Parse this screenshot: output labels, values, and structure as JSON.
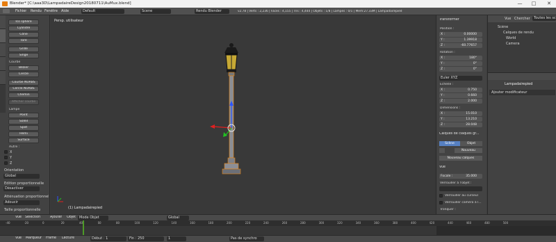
{
  "window": {
    "title": "Blender* [C:\\aaa3D\\LampadaireDesign20180711\\AuMux.blend]",
    "minimize": "—",
    "maximize": "□",
    "close": "✕"
  },
  "menu": {
    "items": [
      "Fichier",
      "Rendu",
      "Fenêtre",
      "Aide"
    ],
    "layout": "Default",
    "scene": "Scene",
    "engine": "Rendu Blender",
    "stats": "v2.78 | Verts : 2,236 | Faces : 4,155 | Tris : 4,444 | Objets : 1/8 | Lampes : 0/1 | Mem:27.33M | Lampadairepied"
  },
  "tool_shelf": {
    "tabs": [
      "Outils",
      "Créer",
      "Relations",
      "Animation",
      "Physique"
    ],
    "mesh_buttons": [
      "Ico sphère",
      "Cylindre",
      "Cône",
      "Tore",
      "Grille",
      "Singe"
    ],
    "curve_header": "Courbe",
    "curve_buttons": [
      "Bézier",
      "Cercle"
    ],
    "nurbs_buttons": [
      "Courbe NURBS",
      "Cercle NURBS",
      "Chemin"
    ],
    "curve_disabled": "Afficher courbe",
    "lamp_header": "Lampe",
    "lamp_buttons": [
      "Point",
      "Soleil",
      "Spot",
      "Hémi",
      "Surface"
    ],
    "other_header": "Autre :",
    "axes": [
      "X",
      "Y",
      "Z"
    ],
    "orientation_label": "Orientation",
    "orientation_value": "Global",
    "prop_edit_label": "Édition proportionnelle",
    "prop_edit_value": "Désactiver",
    "falloff_label": "Atténuation proportionnelle",
    "falloff_value": "Adoucir",
    "size_label": "Taille proportionnelle"
  },
  "viewport": {
    "label": "Persp. utilisateur",
    "object_label": "(1) Lampadairepied"
  },
  "nbar": {
    "transform_header": "Transformer",
    "position_label": "Position :",
    "position": [
      {
        "axis": "X :",
        "value": "0.00000"
      },
      {
        "axis": "Y :",
        "value": "1.39918"
      },
      {
        "axis": "Z :",
        "value": "-60.77657"
      }
    ],
    "rotation_label": "Rotation :",
    "rotation": [
      {
        "axis": "X :",
        "value": "180°"
      },
      {
        "axis": "Y :",
        "value": "0°"
      },
      {
        "axis": "Z :",
        "value": "0°"
      }
    ],
    "rotation_mode": "Euler XYZ",
    "scale_label": "Échelle :",
    "scale": [
      {
        "axis": "X :",
        "value": "0.750"
      },
      {
        "axis": "Y :",
        "value": "0.660"
      },
      {
        "axis": "Z :",
        "value": "2.000"
      }
    ],
    "dims_label": "Dimensions :",
    "dims": [
      {
        "axis": "X :",
        "value": "15.010"
      },
      {
        "axis": "Y :",
        "value": "13.210"
      },
      {
        "axis": "Z :",
        "value": "28.048"
      }
    ],
    "layers_header": "Calques de claques gr...",
    "scene_tab": "Scène",
    "object_tab": "Objet",
    "new_btn": "Nouveau",
    "new_layer_btn": "Nouveau calques",
    "view_header": "Vue",
    "focal_label": "Focale :",
    "focal_value": "35.000",
    "lock_label": "Verrouiller à l'objet :",
    "lock_cursor": "Verrouiller au curseur",
    "lock_camera": "Verrouiller caméra à l...",
    "clip_label": "Tronquer :"
  },
  "outliner": {
    "menus": [
      "Vue",
      "Chercher",
      "Toutes les scènes"
    ],
    "items": [
      "Scène",
      "Calques de rendu",
      "World",
      "Camera"
    ]
  },
  "properties": {
    "object_name": "Lampadairepied",
    "add_modifier": "Ajouter modificateur"
  },
  "viewport_header": {
    "menus": [
      "Vue",
      "Sélection",
      "Ajouter",
      "Objet"
    ],
    "mode": "Mode Objet",
    "pivot": "Global"
  },
  "timeline": {
    "ticks": [
      "-40",
      "-20",
      "0",
      "20",
      "40",
      "60",
      "80",
      "100",
      "120",
      "140",
      "160",
      "180",
      "200",
      "220",
      "240",
      "260",
      "280",
      "300",
      "320",
      "340",
      "360",
      "380",
      "400",
      "420",
      "440",
      "460",
      "480",
      "500"
    ],
    "menus": [
      "Vue",
      "Marqueur",
      "Frame",
      "Lecture"
    ],
    "start_label": "Début :",
    "start": "1",
    "end_label": "Fin :",
    "end": "250",
    "current": "1",
    "sync": "Pas de synchro"
  },
  "colors": {
    "accent": "#e8830c",
    "header": "#505050",
    "panel": "#424242",
    "viewport": "#393939"
  }
}
